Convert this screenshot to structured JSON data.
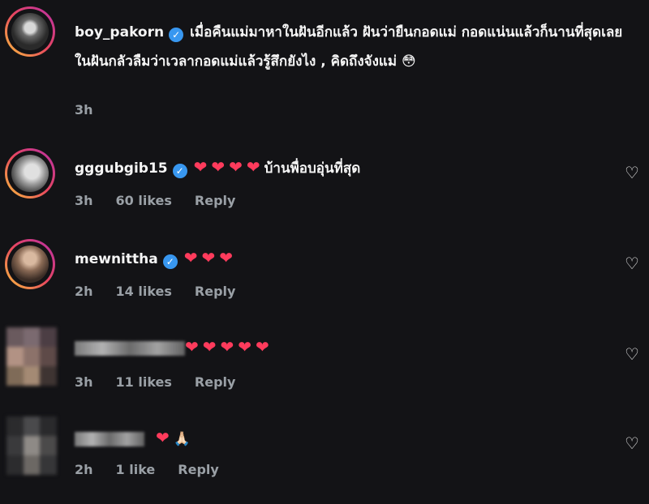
{
  "post": {
    "username": "boy_pakorn",
    "caption": "เมื่อคืนแม่มาหาในฝันอีกแล้ว ฝันว่ายืนกอดแม่ กอดแน่นแล้วก็นานที่สุดเลย ในฝันกลัวลืมว่าเวลากอดแม่แล้วรู้สึกยังไง , คิดถึงจังแม่ 😳",
    "time": "3h"
  },
  "comments": [
    {
      "username": "gggubgib15",
      "hearts": "❤❤❤❤",
      "text": "บ้านพื่อบอุ่นที่สุด",
      "time": "3h",
      "likes": "60 likes",
      "reply": "Reply"
    },
    {
      "username": "mewnittha",
      "hearts": "❤❤❤",
      "text": "",
      "time": "2h",
      "likes": "14 likes",
      "reply": "Reply"
    },
    {
      "username": "",
      "hearts": "❤❤❤❤❤",
      "text": "",
      "time": "3h",
      "likes": "11 likes",
      "reply": "Reply"
    },
    {
      "username": "",
      "hearts": "❤",
      "text": "🙏🏻",
      "time": "2h",
      "likes": "1 like",
      "reply": "Reply"
    }
  ],
  "colors": {
    "background": "#131316",
    "verified": "#3897f0",
    "heart": "#ff3b5c",
    "meta": "#9aa0a6"
  },
  "icons": {
    "verified": "verified-badge-icon",
    "like": "heart-outline-icon"
  }
}
